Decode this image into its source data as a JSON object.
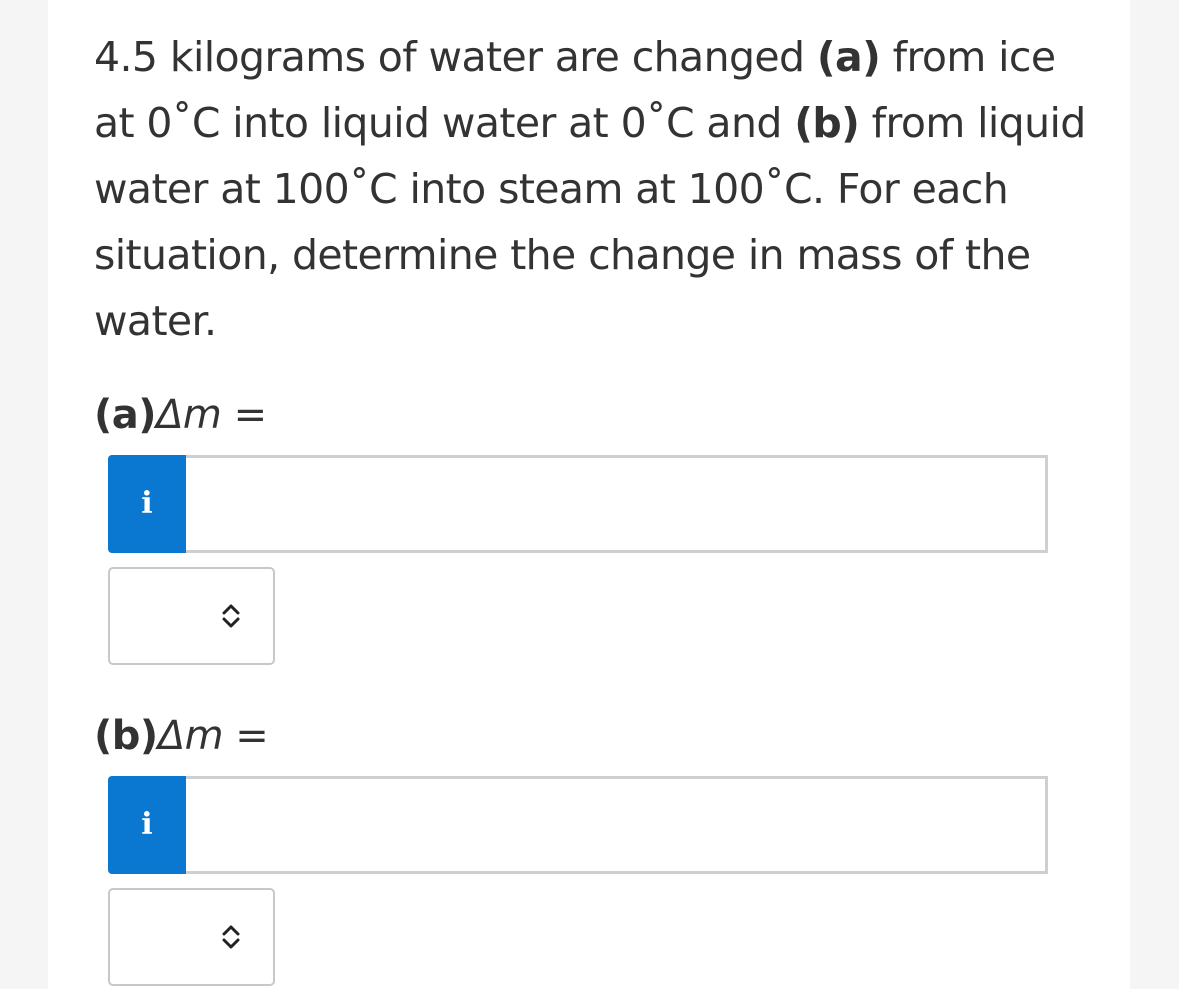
{
  "question": {
    "text_1": "4.5 kilograms of water are changed ",
    "part_a_marker": "(a)",
    "text_2": " from ice at 0˚C into liquid water at 0˚C and ",
    "part_b_marker": "(b)",
    "text_3": " from liquid water at 100˚C into steam at 100˚C. For each situation, determine the change in mass of the water."
  },
  "parts": [
    {
      "paren_label": "(a)",
      "symbol": "Δm",
      "equals": " =",
      "info_glyph": "i",
      "value": "",
      "unit_selected": ""
    },
    {
      "paren_label": "(b)",
      "symbol": "Δm",
      "equals": " =",
      "info_glyph": "i",
      "value": "",
      "unit_selected": ""
    }
  ],
  "icons": {
    "info": "info-icon",
    "select_toggle": "chevron-up-down-icon"
  },
  "colors": {
    "info_button": "#0a78d1",
    "text": "#333333",
    "input_border": "#cfcfcf"
  }
}
